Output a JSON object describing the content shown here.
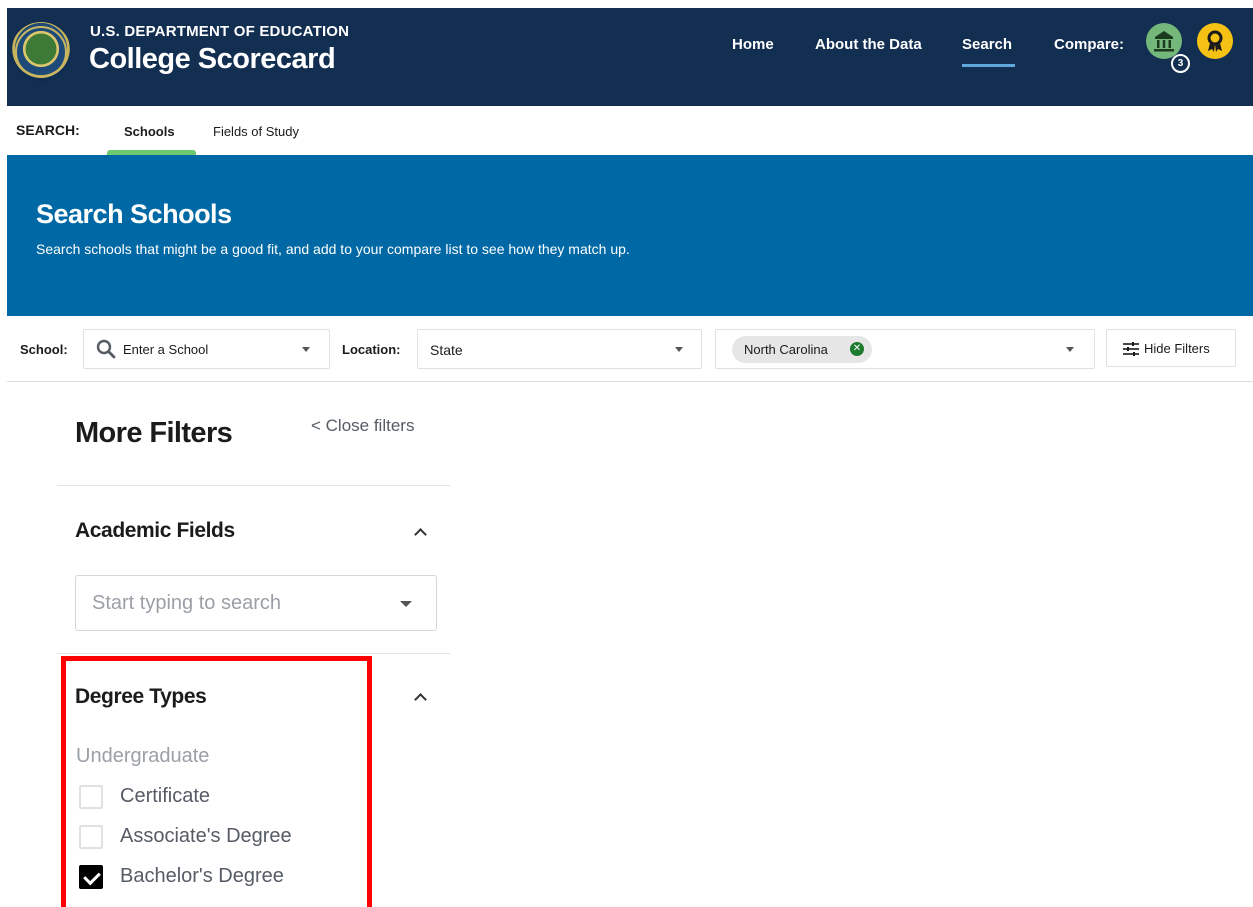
{
  "header": {
    "agency": "U.S. DEPARTMENT OF EDUCATION",
    "title": "College Scorecard",
    "nav": [
      {
        "label": "Home"
      },
      {
        "label": "About the Data"
      },
      {
        "label": "Search",
        "active": true
      },
      {
        "label": "Compare:"
      }
    ],
    "compare_school_count": "3",
    "icons": {
      "seal": "department-of-education-seal",
      "school": "institution-icon",
      "field": "ribbon-award-icon"
    },
    "colors": {
      "background": "#122e51",
      "active_underline": "#60a8dc",
      "school_icon": "#74b77b",
      "field_icon": "#f5c114"
    }
  },
  "subnav": {
    "label": "SEARCH:",
    "tabs": [
      {
        "label": "Schools",
        "active": true
      },
      {
        "label": "Fields of Study"
      }
    ],
    "active_color": "#6cc96f"
  },
  "banner": {
    "title": "Search Schools",
    "subtitle": "Search schools that might be a good fit, and add to your compare list to see how they match up.",
    "color": "#0069a5"
  },
  "search_row": {
    "school_label": "School:",
    "school_placeholder": "Enter a School",
    "location_label": "Location:",
    "location_type": "State",
    "state_chip": "North Carolina",
    "hide_filters": "Hide Filters"
  },
  "filters": {
    "title": "More Filters",
    "close_link": "< Close filters",
    "academic_fields": {
      "title": "Academic Fields",
      "placeholder": "Start typing to search"
    },
    "degree_types": {
      "title": "Degree Types",
      "group_label": "Undergraduate",
      "options": [
        {
          "label": "Certificate",
          "checked": false
        },
        {
          "label": "Associate's Degree",
          "checked": false
        },
        {
          "label": "Bachelor's Degree",
          "checked": true
        }
      ],
      "highlight_color": "#ff0000"
    }
  }
}
